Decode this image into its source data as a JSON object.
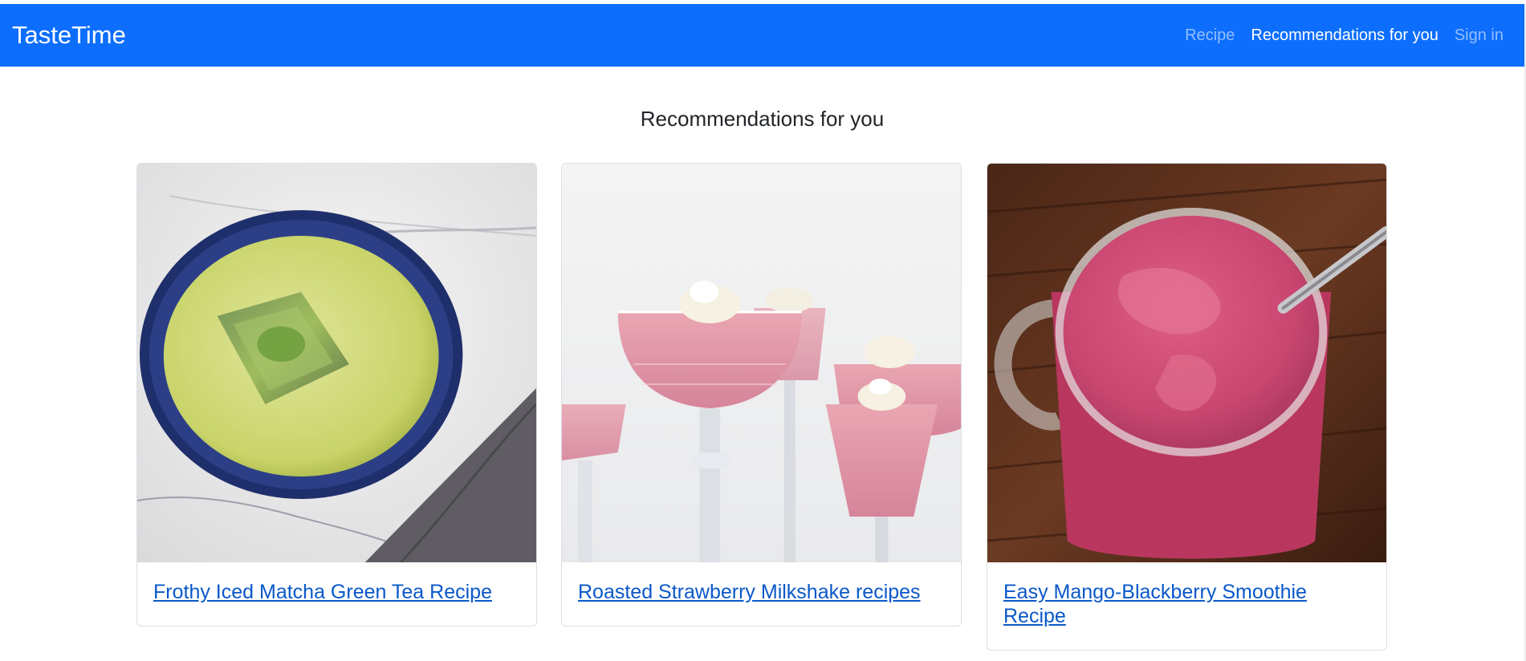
{
  "navbar": {
    "brand": "TasteTime",
    "links": [
      {
        "label": "Recipe",
        "active": false
      },
      {
        "label": "Recommendations for you",
        "active": true
      },
      {
        "label": "Sign in",
        "active": false
      }
    ],
    "bg_color": "#0d6efd"
  },
  "main": {
    "heading": "Recommendations for you",
    "cards": [
      {
        "title": "Frothy Iced Matcha Green Tea Recipe",
        "image": "matcha-photo"
      },
      {
        "title": "Roasted Strawberry Milkshake recipes",
        "image": "strawberry-milkshake-photo"
      },
      {
        "title": "Easy Mango-Blackberry Smoothie Recipe",
        "image": "mango-blackberry-smoothie-photo"
      }
    ]
  }
}
